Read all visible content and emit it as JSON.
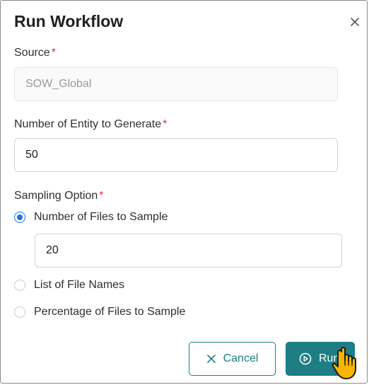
{
  "dialog": {
    "title": "Run Workflow",
    "close_icon": "close-icon"
  },
  "source": {
    "label": "Source",
    "required_mark": "*",
    "value": "SOW_Global"
  },
  "entity_count": {
    "label": "Number of Entity to Generate",
    "required_mark": "*",
    "value": "50"
  },
  "sampling": {
    "label": "Sampling Option",
    "required_mark": "*",
    "options": [
      {
        "label": "Number of Files to Sample",
        "selected": true
      },
      {
        "label": "List of File Names",
        "selected": false
      },
      {
        "label": "Percentage of Files to Sample",
        "selected": false
      }
    ],
    "files_to_sample_value": "20"
  },
  "buttons": {
    "cancel_label": "Cancel",
    "cancel_icon": "x-icon",
    "run_label": "Run",
    "run_icon": "play-circle-icon"
  },
  "colors": {
    "accent": "#1e7e84",
    "radio_selected": "#1a73e8",
    "required": "#d9363e",
    "cursor": "#f7b500"
  }
}
